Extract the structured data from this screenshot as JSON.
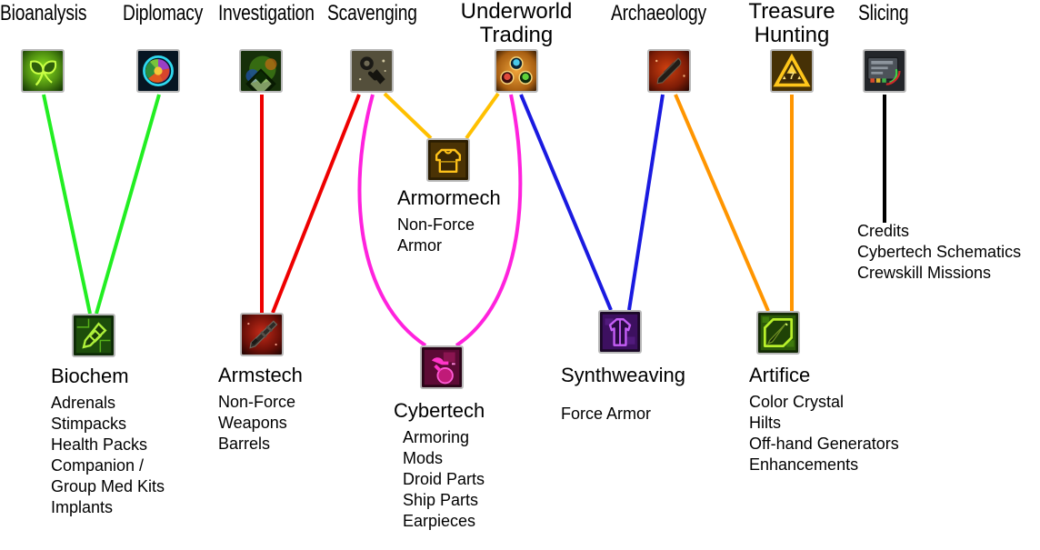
{
  "diagram": {
    "title_font_note": "",
    "gather_nodes": [
      {
        "id": "bioanalysis",
        "label": "Bioanalysis",
        "style": "condensed",
        "icon": "bioanalysis-leaf-icon"
      },
      {
        "id": "diplomacy",
        "label": "Diplomacy",
        "style": "condensed",
        "icon": "diplomacy-sphere-icon"
      },
      {
        "id": "investigation",
        "label": "Investigation",
        "style": "condensed",
        "icon": "investigation-datacron-icon"
      },
      {
        "id": "scavenging",
        "label": "Scavenging",
        "style": "condensed",
        "icon": "scavenging-scrap-icon"
      },
      {
        "id": "underworld",
        "label": "Underworld\nTrading",
        "line1": "Underworld",
        "line2": "Trading",
        "style": "wide",
        "icon": "underworld-trading-icon"
      },
      {
        "id": "archaeology",
        "label": "Archaeology",
        "style": "condensed",
        "icon": "archaeology-relic-icon"
      },
      {
        "id": "treasure",
        "label": "Treasure\nHunting",
        "line1": "Treasure",
        "line2": "Hunting",
        "style": "wide",
        "icon": "treasure-hunting-icon"
      },
      {
        "id": "slicing",
        "label": "Slicing",
        "style": "condensed",
        "icon": "slicing-datapad-icon"
      }
    ],
    "crafting_nodes": [
      {
        "id": "biochem",
        "name": "Biochem",
        "icon": "biochem-icon",
        "items": [
          "Adrenals",
          "Stimpacks",
          "Health Packs",
          "Companion /",
          "Group Med Kits",
          "Implants"
        ]
      },
      {
        "id": "armstech",
        "name": "Armstech",
        "icon": "armstech-rifle-icon",
        "items": [
          "Non-Force",
          "Weapons",
          "Barrels"
        ]
      },
      {
        "id": "armormech",
        "name": "Armormech",
        "icon": "armormech-chestpiece-icon",
        "items": [
          "Non-Force",
          "Armor"
        ]
      },
      {
        "id": "cybertech",
        "name": "Cybertech",
        "icon": "cybertech-icon",
        "items": [
          "Armoring",
          "Mods",
          "Droid Parts",
          "Ship Parts",
          "Earpieces"
        ]
      },
      {
        "id": "synthweaving",
        "name": "Synthweaving",
        "icon": "synthweaving-robe-icon",
        "items": [
          "Force Armor"
        ]
      },
      {
        "id": "artifice",
        "name": "Artifice",
        "icon": "artifice-crystal-icon",
        "items": [
          "Color Crystal",
          "Hilts",
          "Off-hand Generators",
          "Enhancements"
        ]
      }
    ],
    "slicing_outputs": [
      "Credits",
      "Cybertech Schematics",
      "Crewskill Missions"
    ],
    "link_colors": {
      "green": "#22ee22",
      "red": "#ee0000",
      "magenta": "#ff22dd",
      "yellow": "#ffc000",
      "blue": "#1a1ae0",
      "orange": "#ff9500",
      "black": "#000000"
    },
    "links": [
      {
        "from": "bioanalysis",
        "to": "biochem",
        "color": "green"
      },
      {
        "from": "diplomacy",
        "to": "biochem",
        "color": "green"
      },
      {
        "from": "investigation",
        "to": "armstech",
        "color": "red"
      },
      {
        "from": "scavenging",
        "to": "armstech",
        "color": "red"
      },
      {
        "from": "scavenging",
        "to": "cybertech",
        "color": "magenta"
      },
      {
        "from": "scavenging",
        "to": "armormech",
        "color": "yellow"
      },
      {
        "from": "underworld",
        "to": "armormech",
        "color": "yellow"
      },
      {
        "from": "underworld",
        "to": "cybertech",
        "color": "magenta"
      },
      {
        "from": "underworld",
        "to": "synthweaving",
        "color": "blue"
      },
      {
        "from": "archaeology",
        "to": "synthweaving",
        "color": "blue"
      },
      {
        "from": "archaeology",
        "to": "artifice",
        "color": "orange"
      },
      {
        "from": "treasure",
        "to": "artifice",
        "color": "orange"
      },
      {
        "from": "slicing",
        "to": "slicing-outputs",
        "color": "black"
      }
    ]
  }
}
